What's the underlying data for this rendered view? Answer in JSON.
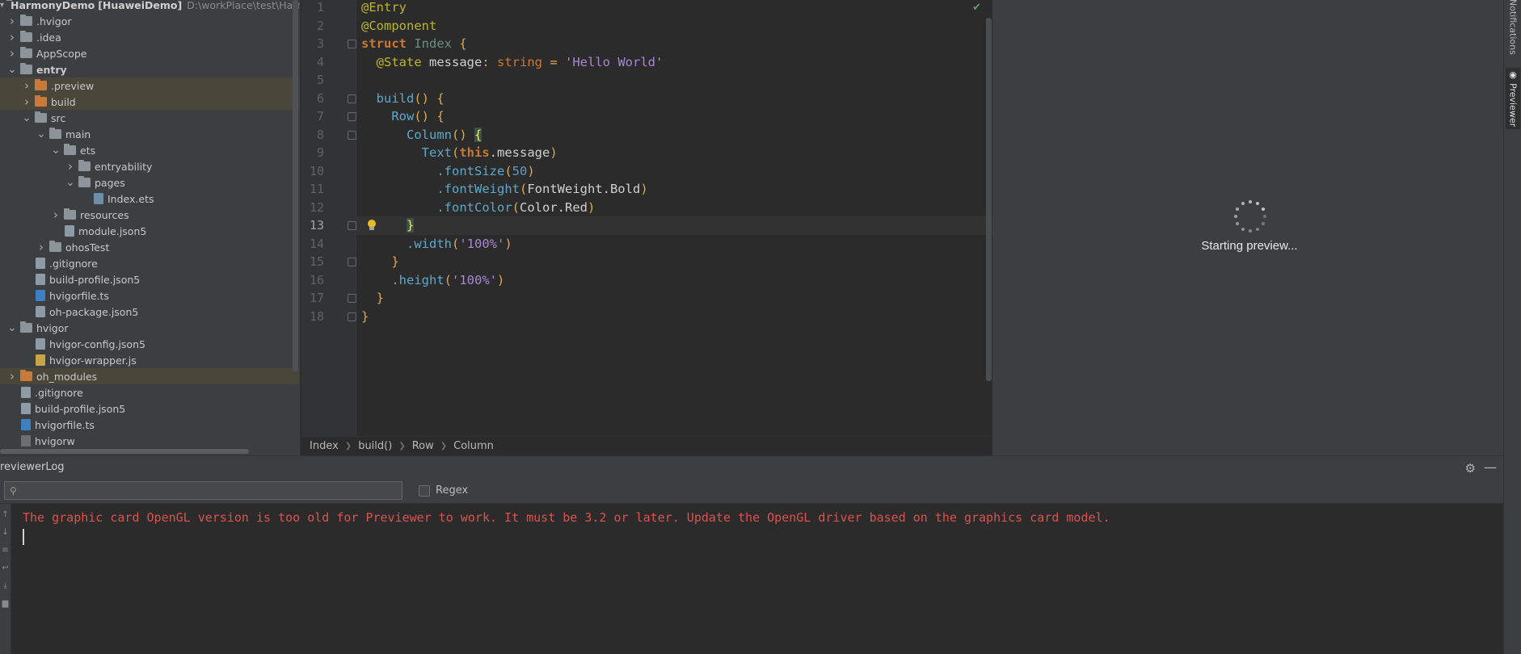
{
  "project": {
    "name": "HarmonyDemo",
    "module_tag": "[HuaweiDemo]",
    "path": "D:\\workPlace\\test\\Harmor",
    "tree": [
      {
        "label": ".hvigor",
        "type": "folder",
        "depth": 1,
        "arrow": "right"
      },
      {
        "label": ".idea",
        "type": "folder",
        "depth": 1,
        "arrow": "right"
      },
      {
        "label": "AppScope",
        "type": "folder",
        "depth": 1,
        "arrow": "right"
      },
      {
        "label": "entry",
        "type": "folder",
        "depth": 1,
        "arrow": "down",
        "bold": true
      },
      {
        "label": ".preview",
        "type": "folder-orange",
        "depth": 2,
        "arrow": "right",
        "highlight": true
      },
      {
        "label": "build",
        "type": "folder-orange",
        "depth": 2,
        "arrow": "right",
        "highlight": true
      },
      {
        "label": "src",
        "type": "folder",
        "depth": 2,
        "arrow": "down"
      },
      {
        "label": "main",
        "type": "folder",
        "depth": 3,
        "arrow": "down"
      },
      {
        "label": "ets",
        "type": "folder",
        "depth": 4,
        "arrow": "down"
      },
      {
        "label": "entryability",
        "type": "folder",
        "depth": 5,
        "arrow": "right"
      },
      {
        "label": "pages",
        "type": "folder",
        "depth": 5,
        "arrow": "down"
      },
      {
        "label": "Index.ets",
        "type": "file-ets",
        "depth": 6,
        "arrow": ""
      },
      {
        "label": "resources",
        "type": "folder",
        "depth": 4,
        "arrow": "right"
      },
      {
        "label": "module.json5",
        "type": "file-json",
        "depth": 4,
        "arrow": ""
      },
      {
        "label": "ohosTest",
        "type": "folder",
        "depth": 3,
        "arrow": "right"
      },
      {
        "label": ".gitignore",
        "type": "file-json",
        "depth": 2,
        "arrow": ""
      },
      {
        "label": "build-profile.json5",
        "type": "file-json",
        "depth": 2,
        "arrow": ""
      },
      {
        "label": "hvigorfile.ts",
        "type": "file-ts",
        "depth": 2,
        "arrow": ""
      },
      {
        "label": "oh-package.json5",
        "type": "file-json",
        "depth": 2,
        "arrow": ""
      },
      {
        "label": "hvigor",
        "type": "folder",
        "depth": 1,
        "arrow": "down"
      },
      {
        "label": "hvigor-config.json5",
        "type": "file-json",
        "depth": 2,
        "arrow": ""
      },
      {
        "label": "hvigor-wrapper.js",
        "type": "file-js",
        "depth": 2,
        "arrow": ""
      },
      {
        "label": "oh_modules",
        "type": "folder-orange",
        "depth": 1,
        "arrow": "right",
        "highlight": true
      },
      {
        "label": ".gitignore",
        "type": "file-json",
        "depth": 1,
        "arrow": ""
      },
      {
        "label": "build-profile.json5",
        "type": "file-json",
        "depth": 1,
        "arrow": ""
      },
      {
        "label": "hvigorfile.ts",
        "type": "file-ts",
        "depth": 1,
        "arrow": ""
      },
      {
        "label": "hvigorw",
        "type": "file-exe",
        "depth": 1,
        "arrow": ""
      }
    ]
  },
  "editor": {
    "line_numbers": [
      "1",
      "2",
      "3",
      "4",
      "5",
      "6",
      "7",
      "8",
      "9",
      "10",
      "11",
      "12",
      "13",
      "14",
      "15",
      "16",
      "17",
      "18"
    ],
    "active_line": "13",
    "lines": [
      [
        [
          "k-ann",
          "@Entry"
        ]
      ],
      [
        [
          "k-ann",
          "@Component"
        ]
      ],
      [
        [
          "k-kw",
          "struct "
        ],
        [
          "k-type",
          "Index "
        ],
        [
          "k-punc",
          "{"
        ]
      ],
      [
        [
          "k-white",
          "  "
        ],
        [
          "k-ann",
          "@State "
        ],
        [
          "k-white",
          "message"
        ],
        [
          "k-punc",
          ": "
        ],
        [
          "k-kw2",
          "string "
        ],
        [
          "k-punc",
          "= "
        ],
        [
          "k-str",
          "'Hello World'"
        ]
      ],
      [],
      [
        [
          "k-white",
          "  "
        ],
        [
          "k-call",
          "build"
        ],
        [
          "k-punc",
          "() {"
        ]
      ],
      [
        [
          "k-white",
          "    "
        ],
        [
          "k-call",
          "Row"
        ],
        [
          "k-punc",
          "() {"
        ]
      ],
      [
        [
          "k-white",
          "      "
        ],
        [
          "k-call",
          "Column"
        ],
        [
          "k-punc",
          "() "
        ],
        [
          "brace-match",
          "{"
        ]
      ],
      [
        [
          "k-white",
          "        "
        ],
        [
          "k-call",
          "Text"
        ],
        [
          "k-punc",
          "("
        ],
        [
          "k-this",
          "this"
        ],
        [
          "k-white",
          ".message"
        ],
        [
          "k-punc",
          ")"
        ]
      ],
      [
        [
          "k-white",
          "          "
        ],
        [
          "k-mem",
          ".fontSize"
        ],
        [
          "k-punc",
          "("
        ],
        [
          "k-num",
          "50"
        ],
        [
          "k-punc",
          ")"
        ]
      ],
      [
        [
          "k-white",
          "          "
        ],
        [
          "k-mem",
          ".fontWeight"
        ],
        [
          "k-punc",
          "("
        ],
        [
          "k-white",
          "FontWeight.Bold"
        ],
        [
          "k-punc",
          ")"
        ]
      ],
      [
        [
          "k-white",
          "          "
        ],
        [
          "k-mem",
          ".fontColor"
        ],
        [
          "k-punc",
          "("
        ],
        [
          "k-white",
          "Color.Red"
        ],
        [
          "k-punc",
          ")"
        ]
      ],
      [
        [
          "k-white",
          "      "
        ],
        [
          "brace-match",
          "}"
        ]
      ],
      [
        [
          "k-white",
          "      "
        ],
        [
          "k-mem",
          ".width"
        ],
        [
          "k-punc",
          "("
        ],
        [
          "k-str",
          "'100%'"
        ],
        [
          "k-punc",
          ")"
        ]
      ],
      [
        [
          "k-white",
          "    "
        ],
        [
          "k-punc",
          "}"
        ]
      ],
      [
        [
          "k-white",
          "    "
        ],
        [
          "k-mem",
          ".height"
        ],
        [
          "k-punc",
          "("
        ],
        [
          "k-str",
          "'100%'"
        ],
        [
          "k-punc",
          ")"
        ]
      ],
      [
        [
          "k-white",
          "  "
        ],
        [
          "k-punc",
          "}"
        ]
      ],
      [
        [
          "k-punc",
          "}"
        ]
      ]
    ],
    "check_icon": "check-icon",
    "breadcrumb": [
      "Index",
      "build()",
      "Row",
      "Column"
    ]
  },
  "previewer": {
    "status": "Starting preview...",
    "tab_label": "Previewer",
    "notifications_label": "Notifications"
  },
  "log": {
    "title": "reviewerLog",
    "search_placeholder": "",
    "regex_label": "Regex",
    "error_message": "The graphic card OpenGL version is too old for Previewer to work. It must be 3.2 or later. Update the OpenGL driver based on the graphics card model."
  },
  "colors": {
    "error": "#d9534f",
    "accent_check": "#58a65c"
  }
}
